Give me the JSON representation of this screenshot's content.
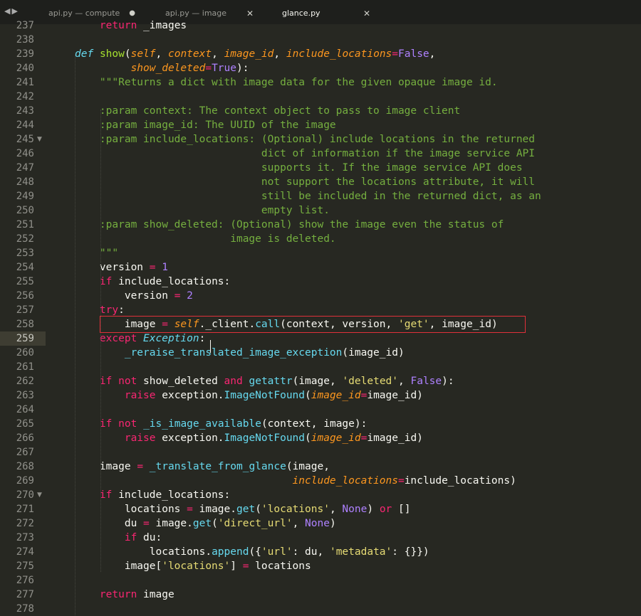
{
  "tabs": [
    {
      "label": "api.py — compute",
      "state": "modified"
    },
    {
      "label": "api.py — image",
      "state": "close"
    },
    {
      "label": "glance.py",
      "state": "active"
    }
  ],
  "editor": {
    "current_line": 259,
    "lines": [
      {
        "n": 237,
        "html": "    <span class=\"kw\">return</span> _images"
      },
      {
        "n": 238,
        "html": ""
      },
      {
        "n": 239,
        "html": "<span class=\"def\">def</span> <span class=\"fn\">show</span>(<span class=\"param\">self</span>, <span class=\"param\">context</span>, <span class=\"param\">image_id</span>, <span class=\"param\">include_locations</span><span class=\"op\">=</span><span class=\"const\">False</span>,"
      },
      {
        "n": 240,
        "html": "         <span class=\"param\">show_deleted</span><span class=\"op\">=</span><span class=\"const\">True</span>):"
      },
      {
        "n": 241,
        "html": "    <span class=\"cmt\">\"\"\"Returns a dict with image data for the given opaque image id.</span>"
      },
      {
        "n": 242,
        "html": ""
      },
      {
        "n": 243,
        "html": "    <span class=\"cmt\">:param context: The context object to pass to image client</span>"
      },
      {
        "n": 244,
        "html": "    <span class=\"cmt\">:param image_id: The UUID of the image</span>"
      },
      {
        "n": 245,
        "html": "    <span class=\"cmt\">:param include_locations: (Optional) include locations in the returned</span>",
        "fold": true
      },
      {
        "n": 246,
        "html": "    <span class=\"cmt\">                          dict of information if the image service API</span>"
      },
      {
        "n": 247,
        "html": "    <span class=\"cmt\">                          supports it. If the image service API does</span>"
      },
      {
        "n": 248,
        "html": "    <span class=\"cmt\">                          not support the locations attribute, it will</span>"
      },
      {
        "n": 249,
        "html": "    <span class=\"cmt\">                          still be included in the returned dict, as an</span>"
      },
      {
        "n": 250,
        "html": "    <span class=\"cmt\">                          empty list.</span>"
      },
      {
        "n": 251,
        "html": "    <span class=\"cmt\">:param show_deleted: (Optional) show the image even the status of</span>"
      },
      {
        "n": 252,
        "html": "    <span class=\"cmt\">                     image is deleted.</span>"
      },
      {
        "n": 253,
        "html": "    <span class=\"cmt\">\"\"\"</span>"
      },
      {
        "n": 254,
        "html": "    version <span class=\"op\">=</span> <span class=\"num\">1</span>"
      },
      {
        "n": 255,
        "html": "    <span class=\"kw\">if</span> include_locations:"
      },
      {
        "n": 256,
        "html": "        version <span class=\"op\">=</span> <span class=\"num\">2</span>"
      },
      {
        "n": 257,
        "html": "    <span class=\"kw\">try</span>:"
      },
      {
        "n": 258,
        "html": "        image <span class=\"op\">=</span> <span class=\"self\">self</span>._client.<span class=\"call\">call</span>(context, version, <span class=\"str\">'get'</span>, image_id)"
      },
      {
        "n": 259,
        "html": "    <span class=\"kw\">except</span> <span class=\"cls\">Exception</span>:"
      },
      {
        "n": 260,
        "html": "        <span class=\"call\">_reraise_translated_image_exception</span>(image_id)"
      },
      {
        "n": 261,
        "html": ""
      },
      {
        "n": 262,
        "html": "    <span class=\"kw\">if</span> <span class=\"kw\">not</span> show_deleted <span class=\"kw\">and</span> <span class=\"call\">getattr</span>(image, <span class=\"str\">'deleted'</span>, <span class=\"const\">False</span>):"
      },
      {
        "n": 263,
        "html": "        <span class=\"kw\">raise</span> exception.<span class=\"call\">ImageNotFound</span>(<span class=\"param\">image_id</span><span class=\"op\">=</span>image_id)"
      },
      {
        "n": 264,
        "html": ""
      },
      {
        "n": 265,
        "html": "    <span class=\"kw\">if</span> <span class=\"kw\">not</span> <span class=\"call\">_is_image_available</span>(context, image):"
      },
      {
        "n": 266,
        "html": "        <span class=\"kw\">raise</span> exception.<span class=\"call\">ImageNotFound</span>(<span class=\"param\">image_id</span><span class=\"op\">=</span>image_id)"
      },
      {
        "n": 267,
        "html": ""
      },
      {
        "n": 268,
        "html": "    image <span class=\"op\">=</span> <span class=\"call\">_translate_from_glance</span>(image,"
      },
      {
        "n": 269,
        "html": "                                   <span class=\"param\">include_locations</span><span class=\"op\">=</span>include_locations)"
      },
      {
        "n": 270,
        "html": "    <span class=\"kw\">if</span> include_locations:",
        "fold": true
      },
      {
        "n": 271,
        "html": "        locations <span class=\"op\">=</span> image.<span class=\"call\">get</span>(<span class=\"str\">'locations'</span>, <span class=\"const\">None</span>) <span class=\"kw\">or</span> []"
      },
      {
        "n": 272,
        "html": "        du <span class=\"op\">=</span> image.<span class=\"call\">get</span>(<span class=\"str\">'direct_url'</span>, <span class=\"const\">None</span>)"
      },
      {
        "n": 273,
        "html": "        <span class=\"kw\">if</span> du:"
      },
      {
        "n": 274,
        "html": "            locations.<span class=\"call\">append</span>({<span class=\"str\">'url'</span>: du, <span class=\"str\">'metadata'</span>: {}})"
      },
      {
        "n": 275,
        "html": "        image[<span class=\"str\">'locations'</span>] <span class=\"op\">=</span> locations"
      },
      {
        "n": 276,
        "html": ""
      },
      {
        "n": 277,
        "html": "    <span class=\"kw\">return</span> image"
      },
      {
        "n": 278,
        "html": ""
      }
    ]
  },
  "icons": {
    "nav": "left-right-arrows-icon",
    "close": "close-icon",
    "modified": "modified-dot-icon"
  },
  "colors": {
    "background": "#272822",
    "highlight_box": "#e0303a",
    "keyword": "#f92672",
    "function": "#a6e22e",
    "comment": "#75af3f"
  }
}
